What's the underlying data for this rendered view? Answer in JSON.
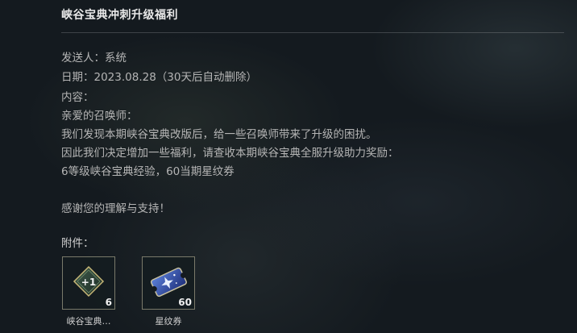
{
  "mail": {
    "title": "峡谷宝典冲刺升级福利",
    "sender": "发送人：系统",
    "date": "日期：2023.08.28（30天后自动删除）",
    "content_label": "内容：",
    "lines": [
      "亲爱的召唤师：",
      "我们发现本期峡谷宝典改版后，给一些召唤师带来了升级的困扰。",
      "因此我们决定增加一些福利，请查收本期峡谷宝典全服升级助力奖励：",
      "6等级峡谷宝典经验，60当期星纹券",
      "",
      "感谢您的理解与支持！"
    ],
    "attachments_label": "附件：",
    "attachments": [
      {
        "icon": "plus-one-exp-icon",
        "badge": "+1",
        "count": "6",
        "name": "峡谷宝典…"
      },
      {
        "icon": "star-ticket-icon",
        "count": "60",
        "name": "星纹券"
      }
    ]
  },
  "colors": {
    "background": "#141a1f",
    "title": "#e8e8e8",
    "text": "#b5b5b5",
    "item_border": "#7a7a6a"
  }
}
